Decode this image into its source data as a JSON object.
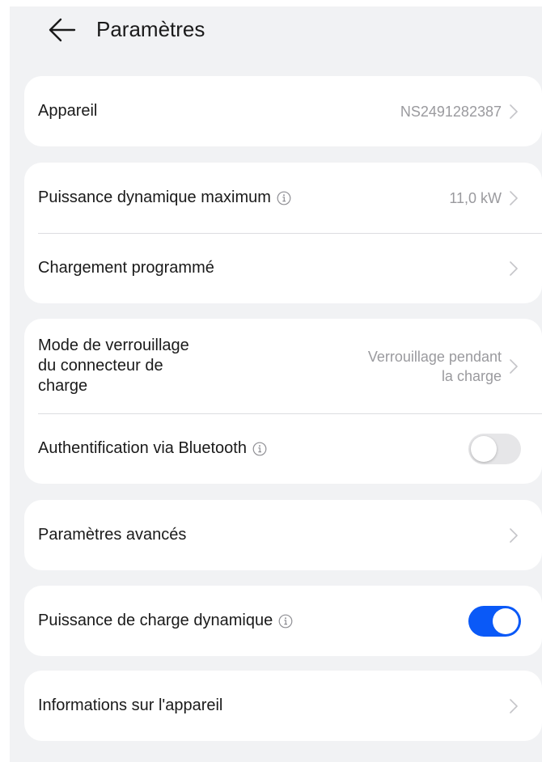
{
  "header": {
    "title": "Paramètres",
    "back_icon": "arrow-left-icon"
  },
  "device": {
    "label": "Appareil",
    "value": "NS2491282387"
  },
  "power": {
    "max_dynamic_label": "Puissance dynamique maximum",
    "max_dynamic_value": "11,0 kW",
    "scheduled_label": "Chargement programmé"
  },
  "lock": {
    "mode_label": "Mode de verrouillage\ndu connecteur de\ncharge",
    "mode_value": "Verrouillage pendant\nla charge",
    "bluetooth_label": "Authentification via Bluetooth",
    "bluetooth_enabled": false
  },
  "advanced": {
    "label": "Paramètres avancés"
  },
  "dynamic_charge": {
    "label": "Puissance de charge dynamique",
    "enabled": true
  },
  "device_info": {
    "label": "Informations sur l'appareil"
  },
  "colors": {
    "background": "#f1f2f4",
    "card": "#ffffff",
    "accent": "#0a59f7",
    "secondary_text": "#9a9a9e"
  }
}
